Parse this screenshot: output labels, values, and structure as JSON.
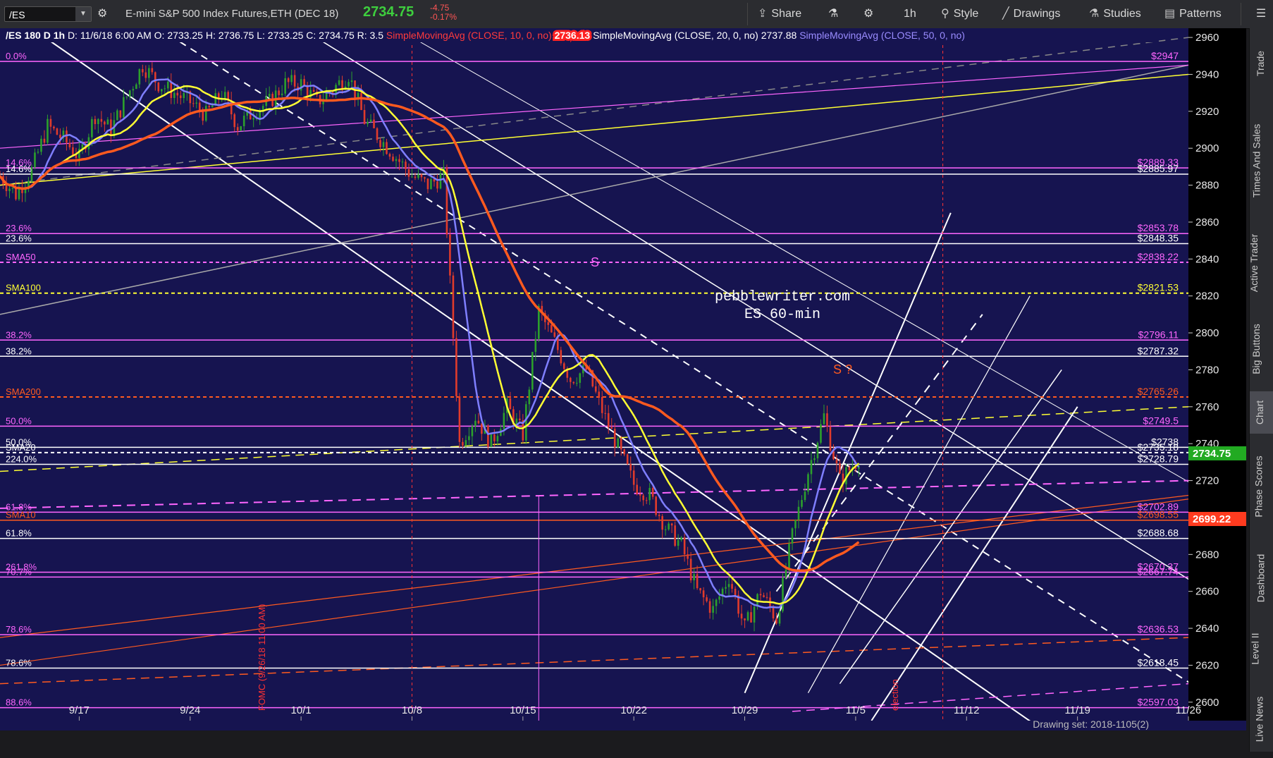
{
  "toolbar": {
    "symbol": "/ES",
    "instrument": "E-mini S&P 500 Index Futures,ETH (DEC 18)",
    "last": "2734.75",
    "change": "-4.75",
    "change_pct": "-0.17%",
    "share": "Share",
    "interval": "1h",
    "style": "Style",
    "drawings": "Drawings",
    "studies": "Studies",
    "patterns": "Patterns"
  },
  "header": {
    "info": "/ES 180 D 1h",
    "date": "D: 11/6/18 6:00 AM",
    "open": "O: 2733.25",
    "high": "H: 2736.75",
    "low": "L: 2733.25",
    "close": "C: 2734.75",
    "range": "R: 3.5",
    "sma10": "SimpleMovingAvg (CLOSE, 10, 0, no)",
    "sma10v": "2736.13",
    "sma20": "SimpleMovingAvg (CLOSE, 20, 0, no)",
    "sma20v": "2737.88",
    "sma50": "SimpleMovingAvg (CLOSE, 50, 0, no)"
  },
  "right_tabs": [
    "Trade",
    "Times And Sales",
    "Active Trader",
    "Big Buttons",
    "Chart",
    "Phase Scores",
    "Dashboard",
    "Level II",
    "Live News"
  ],
  "watermark": [
    "pebblewriter.com",
    "ES 60-min"
  ],
  "annotations": {
    "s1": "S",
    "s2": "S ?",
    "fomc": "FOMC (9/26/18 11:00 AM)",
    "election": "election"
  },
  "drawing_set": "Drawing set: 2018-1105(2)",
  "colors": {
    "bg": "#161450",
    "up": "#2ca02c",
    "down": "#e03b2b",
    "sma10": "#7f7fff",
    "sma20": "#ffff33",
    "sma50": "#ff5a1f",
    "magenta": "#ff66ff",
    "white": "#ffffff"
  },
  "chart_data": {
    "type": "candlestick",
    "ylim": [
      2590,
      2965
    ],
    "y_ticks": [
      2600,
      2620,
      2640,
      2660,
      2680,
      2700,
      2720,
      2740,
      2760,
      2780,
      2800,
      2820,
      2840,
      2860,
      2880,
      2900,
      2920,
      2940,
      2960
    ],
    "x_ticks": [
      "9/17",
      "9/24",
      "10/1",
      "10/8",
      "10/15",
      "10/22",
      "10/29",
      "11/5",
      "11/12",
      "11/19",
      "11/26"
    ],
    "x_tick_day": [
      0,
      7,
      14,
      21,
      28,
      35,
      42,
      49,
      56,
      63,
      70
    ],
    "day_start": -5,
    "day_end": 70,
    "close_path": [
      [
        -5,
        2885
      ],
      [
        -4,
        2875
      ],
      [
        -3,
        2888
      ],
      [
        -2,
        2912
      ],
      [
        -1,
        2905
      ],
      [
        0,
        2895
      ],
      [
        1,
        2918
      ],
      [
        2,
        2910
      ],
      [
        3,
        2928
      ],
      [
        4,
        2945
      ],
      [
        5,
        2935
      ],
      [
        6,
        2930
      ],
      [
        7,
        2925
      ],
      [
        8,
        2918
      ],
      [
        9,
        2930
      ],
      [
        10,
        2912
      ],
      [
        11,
        2920
      ],
      [
        12,
        2925
      ],
      [
        13,
        2935
      ],
      [
        14,
        2935
      ],
      [
        15,
        2925
      ],
      [
        16,
        2932
      ],
      [
        17,
        2940
      ],
      [
        18,
        2915
      ],
      [
        19,
        2905
      ],
      [
        20,
        2895
      ],
      [
        21,
        2885
      ],
      [
        22,
        2880
      ],
      [
        23,
        2885
      ],
      [
        24,
        2740
      ],
      [
        25,
        2755
      ],
      [
        26,
        2740
      ],
      [
        27,
        2760
      ],
      [
        28,
        2745
      ],
      [
        29,
        2812
      ],
      [
        30,
        2795
      ],
      [
        31,
        2775
      ],
      [
        32,
        2780
      ],
      [
        33,
        2758
      ],
      [
        34,
        2738
      ],
      [
        35,
        2718
      ],
      [
        36,
        2712
      ],
      [
        37,
        2695
      ],
      [
        38,
        2685
      ],
      [
        39,
        2660
      ],
      [
        40,
        2650
      ],
      [
        41,
        2668
      ],
      [
        42,
        2640
      ],
      [
        43,
        2660
      ],
      [
        44,
        2645
      ],
      [
        45,
        2690
      ],
      [
        46,
        2725
      ],
      [
        47,
        2755
      ],
      [
        48,
        2720
      ],
      [
        49,
        2730
      ],
      [
        49.4,
        2734.75
      ]
    ],
    "levels": [
      {
        "price": 2947,
        "label": "$2947",
        "color": "#ff66ff",
        "left": "0.0%"
      },
      {
        "price": 2889.33,
        "label": "$2889.33",
        "color": "#ff66ff",
        "left": "14.6%"
      },
      {
        "price": 2885.97,
        "label": "$2885.97",
        "color": "#ffffff",
        "left": "14.6%"
      },
      {
        "price": 2853.78,
        "label": "$2853.78",
        "color": "#ff66ff",
        "left": "23.6%"
      },
      {
        "price": 2848.35,
        "label": "$2848.35",
        "color": "#ffffff",
        "left": "23.6%"
      },
      {
        "price": 2838.22,
        "label": "$2838.22",
        "color": "#ff66ff",
        "left": "SMA50",
        "dash": true
      },
      {
        "price": 2821.53,
        "label": "$2821.53",
        "color": "#ffff33",
        "left": "SMA100",
        "dash": true
      },
      {
        "price": 2796.11,
        "label": "$2796.11",
        "color": "#ff66ff",
        "left": "38.2%"
      },
      {
        "price": 2787.32,
        "label": "$2787.32",
        "color": "#ffffff",
        "left": "38.2%"
      },
      {
        "price": 2765.26,
        "label": "$2765.26",
        "color": "#ff5a1f",
        "left": "SMA200",
        "dash": true
      },
      {
        "price": 2749.5,
        "label": "$2749.5",
        "color": "#ff66ff",
        "left": "50.0%"
      },
      {
        "price": 2738,
        "label": "$2738",
        "color": "#ffffff",
        "left": "50.0%"
      },
      {
        "price": 2735.18,
        "label": "$2735.18",
        "color": "#ffffff",
        "left": "SMA20",
        "dash": true
      },
      {
        "price": 2728.79,
        "label": "$2728.79",
        "color": "#ffffff",
        "left": "224.0%"
      },
      {
        "price": 2702.89,
        "label": "$2702.89",
        "color": "#ff66ff",
        "left": "61.8%"
      },
      {
        "price": 2698.55,
        "label": "$2698.55",
        "color": "#ff5a1f",
        "left": "SMA10"
      },
      {
        "price": 2688.68,
        "label": "$2688.68",
        "color": "#ffffff",
        "left": "61.8%"
      },
      {
        "price": 2670.37,
        "label": "$2670.37",
        "color": "#ff66ff",
        "left": "261.8%"
      },
      {
        "price": 2667.74,
        "label": "$2667.74",
        "color": "#ff66ff",
        "left": "70.7%"
      },
      {
        "price": 2636.53,
        "label": "$2636.53",
        "color": "#ff66ff",
        "left": "78.6%"
      },
      {
        "price": 2618.45,
        "label": "$2618.45",
        "color": "#ffffff",
        "left": "78.6%"
      },
      {
        "price": 2597.03,
        "label": "$2597.03",
        "color": "#ff66ff",
        "left": "88.6%"
      }
    ],
    "price_boxes": [
      {
        "price": 2734.75,
        "label": "2734.75",
        "color": "#22aa22"
      },
      {
        "price": 2699.22,
        "label": "2699.22",
        "color": "#ff3b1f"
      }
    ]
  }
}
